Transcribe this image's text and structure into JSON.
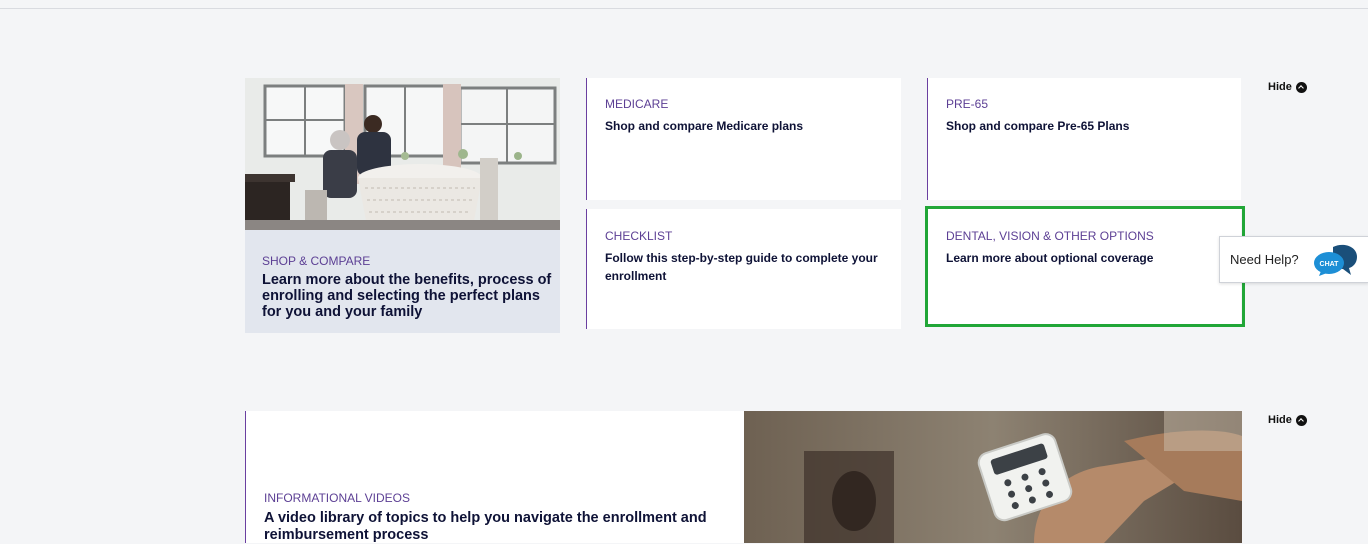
{
  "shop_compare": {
    "eyebrow": "SHOP & COMPARE",
    "headline": "Learn more about the benefits, process of enrolling and selecting the perfect plans for you and your family"
  },
  "tiles": [
    {
      "eyebrow": "MEDICARE",
      "title": "Shop and compare Medicare plans"
    },
    {
      "eyebrow": "PRE-65",
      "title": "Shop and compare Pre-65 Plans"
    },
    {
      "eyebrow": "CHECKLIST",
      "title": "Follow this step-by-step guide to complete your enrollment"
    },
    {
      "eyebrow": "DENTAL, VISION & OTHER OPTIONS",
      "title": "Learn more about optional coverage"
    }
  ],
  "hide_label": "Hide",
  "need_help": {
    "label": "Need Help?",
    "chat_badge": "CHAT"
  },
  "videos": {
    "eyebrow": "INFORMATIONAL VIDEOS",
    "headline": "A video library of topics to help you navigate the enrollment and reimbursement process"
  },
  "colors": {
    "accent_purple": "#6a3fa0",
    "highlight_green": "#21a637",
    "navy": "#0e1236",
    "chat_blue": "#1d8fd6"
  }
}
